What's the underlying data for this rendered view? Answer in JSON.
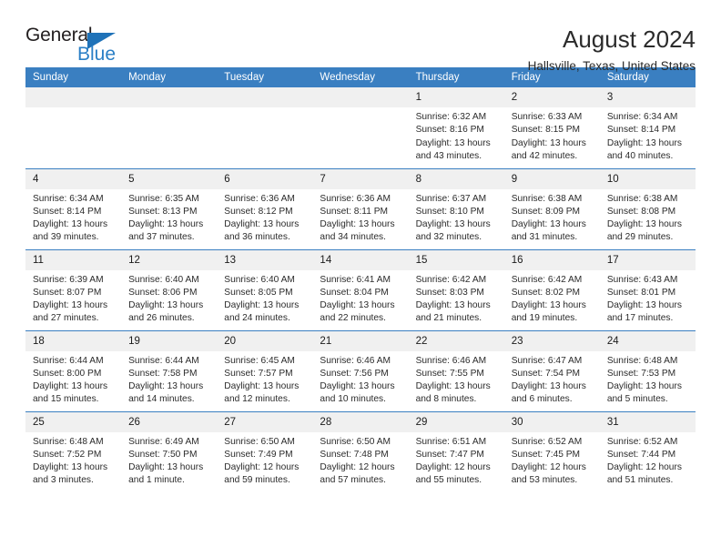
{
  "brand": {
    "name_part1": "General",
    "name_part2": "Blue",
    "triangle_color": "#1f72b8",
    "blue_color": "#2a7fc6"
  },
  "header": {
    "title": "August 2024",
    "subtitle": "Hallsville, Texas, United States"
  },
  "theme": {
    "header_blue": "#3a7fc1",
    "daynum_band": "#f0f0f0",
    "text": "#2b2b2b"
  },
  "weekday_headers": [
    "Sunday",
    "Monday",
    "Tuesday",
    "Wednesday",
    "Thursday",
    "Friday",
    "Saturday"
  ],
  "weeks": [
    [
      {
        "day": "",
        "sunrise": "",
        "sunset": "",
        "daylight_line1": "",
        "daylight_line2": "",
        "empty": true
      },
      {
        "day": "",
        "sunrise": "",
        "sunset": "",
        "daylight_line1": "",
        "daylight_line2": "",
        "empty": true
      },
      {
        "day": "",
        "sunrise": "",
        "sunset": "",
        "daylight_line1": "",
        "daylight_line2": "",
        "empty": true
      },
      {
        "day": "",
        "sunrise": "",
        "sunset": "",
        "daylight_line1": "",
        "daylight_line2": "",
        "empty": true
      },
      {
        "day": "1",
        "sunrise": "Sunrise: 6:32 AM",
        "sunset": "Sunset: 8:16 PM",
        "daylight_line1": "Daylight: 13 hours",
        "daylight_line2": "and 43 minutes."
      },
      {
        "day": "2",
        "sunrise": "Sunrise: 6:33 AM",
        "sunset": "Sunset: 8:15 PM",
        "daylight_line1": "Daylight: 13 hours",
        "daylight_line2": "and 42 minutes."
      },
      {
        "day": "3",
        "sunrise": "Sunrise: 6:34 AM",
        "sunset": "Sunset: 8:14 PM",
        "daylight_line1": "Daylight: 13 hours",
        "daylight_line2": "and 40 minutes."
      }
    ],
    [
      {
        "day": "4",
        "sunrise": "Sunrise: 6:34 AM",
        "sunset": "Sunset: 8:14 PM",
        "daylight_line1": "Daylight: 13 hours",
        "daylight_line2": "and 39 minutes."
      },
      {
        "day": "5",
        "sunrise": "Sunrise: 6:35 AM",
        "sunset": "Sunset: 8:13 PM",
        "daylight_line1": "Daylight: 13 hours",
        "daylight_line2": "and 37 minutes."
      },
      {
        "day": "6",
        "sunrise": "Sunrise: 6:36 AM",
        "sunset": "Sunset: 8:12 PM",
        "daylight_line1": "Daylight: 13 hours",
        "daylight_line2": "and 36 minutes."
      },
      {
        "day": "7",
        "sunrise": "Sunrise: 6:36 AM",
        "sunset": "Sunset: 8:11 PM",
        "daylight_line1": "Daylight: 13 hours",
        "daylight_line2": "and 34 minutes."
      },
      {
        "day": "8",
        "sunrise": "Sunrise: 6:37 AM",
        "sunset": "Sunset: 8:10 PM",
        "daylight_line1": "Daylight: 13 hours",
        "daylight_line2": "and 32 minutes."
      },
      {
        "day": "9",
        "sunrise": "Sunrise: 6:38 AM",
        "sunset": "Sunset: 8:09 PM",
        "daylight_line1": "Daylight: 13 hours",
        "daylight_line2": "and 31 minutes."
      },
      {
        "day": "10",
        "sunrise": "Sunrise: 6:38 AM",
        "sunset": "Sunset: 8:08 PM",
        "daylight_line1": "Daylight: 13 hours",
        "daylight_line2": "and 29 minutes."
      }
    ],
    [
      {
        "day": "11",
        "sunrise": "Sunrise: 6:39 AM",
        "sunset": "Sunset: 8:07 PM",
        "daylight_line1": "Daylight: 13 hours",
        "daylight_line2": "and 27 minutes."
      },
      {
        "day": "12",
        "sunrise": "Sunrise: 6:40 AM",
        "sunset": "Sunset: 8:06 PM",
        "daylight_line1": "Daylight: 13 hours",
        "daylight_line2": "and 26 minutes."
      },
      {
        "day": "13",
        "sunrise": "Sunrise: 6:40 AM",
        "sunset": "Sunset: 8:05 PM",
        "daylight_line1": "Daylight: 13 hours",
        "daylight_line2": "and 24 minutes."
      },
      {
        "day": "14",
        "sunrise": "Sunrise: 6:41 AM",
        "sunset": "Sunset: 8:04 PM",
        "daylight_line1": "Daylight: 13 hours",
        "daylight_line2": "and 22 minutes."
      },
      {
        "day": "15",
        "sunrise": "Sunrise: 6:42 AM",
        "sunset": "Sunset: 8:03 PM",
        "daylight_line1": "Daylight: 13 hours",
        "daylight_line2": "and 21 minutes."
      },
      {
        "day": "16",
        "sunrise": "Sunrise: 6:42 AM",
        "sunset": "Sunset: 8:02 PM",
        "daylight_line1": "Daylight: 13 hours",
        "daylight_line2": "and 19 minutes."
      },
      {
        "day": "17",
        "sunrise": "Sunrise: 6:43 AM",
        "sunset": "Sunset: 8:01 PM",
        "daylight_line1": "Daylight: 13 hours",
        "daylight_line2": "and 17 minutes."
      }
    ],
    [
      {
        "day": "18",
        "sunrise": "Sunrise: 6:44 AM",
        "sunset": "Sunset: 8:00 PM",
        "daylight_line1": "Daylight: 13 hours",
        "daylight_line2": "and 15 minutes."
      },
      {
        "day": "19",
        "sunrise": "Sunrise: 6:44 AM",
        "sunset": "Sunset: 7:58 PM",
        "daylight_line1": "Daylight: 13 hours",
        "daylight_line2": "and 14 minutes."
      },
      {
        "day": "20",
        "sunrise": "Sunrise: 6:45 AM",
        "sunset": "Sunset: 7:57 PM",
        "daylight_line1": "Daylight: 13 hours",
        "daylight_line2": "and 12 minutes."
      },
      {
        "day": "21",
        "sunrise": "Sunrise: 6:46 AM",
        "sunset": "Sunset: 7:56 PM",
        "daylight_line1": "Daylight: 13 hours",
        "daylight_line2": "and 10 minutes."
      },
      {
        "day": "22",
        "sunrise": "Sunrise: 6:46 AM",
        "sunset": "Sunset: 7:55 PM",
        "daylight_line1": "Daylight: 13 hours",
        "daylight_line2": "and 8 minutes."
      },
      {
        "day": "23",
        "sunrise": "Sunrise: 6:47 AM",
        "sunset": "Sunset: 7:54 PM",
        "daylight_line1": "Daylight: 13 hours",
        "daylight_line2": "and 6 minutes."
      },
      {
        "day": "24",
        "sunrise": "Sunrise: 6:48 AM",
        "sunset": "Sunset: 7:53 PM",
        "daylight_line1": "Daylight: 13 hours",
        "daylight_line2": "and 5 minutes."
      }
    ],
    [
      {
        "day": "25",
        "sunrise": "Sunrise: 6:48 AM",
        "sunset": "Sunset: 7:52 PM",
        "daylight_line1": "Daylight: 13 hours",
        "daylight_line2": "and 3 minutes."
      },
      {
        "day": "26",
        "sunrise": "Sunrise: 6:49 AM",
        "sunset": "Sunset: 7:50 PM",
        "daylight_line1": "Daylight: 13 hours",
        "daylight_line2": "and 1 minute."
      },
      {
        "day": "27",
        "sunrise": "Sunrise: 6:50 AM",
        "sunset": "Sunset: 7:49 PM",
        "daylight_line1": "Daylight: 12 hours",
        "daylight_line2": "and 59 minutes."
      },
      {
        "day": "28",
        "sunrise": "Sunrise: 6:50 AM",
        "sunset": "Sunset: 7:48 PM",
        "daylight_line1": "Daylight: 12 hours",
        "daylight_line2": "and 57 minutes."
      },
      {
        "day": "29",
        "sunrise": "Sunrise: 6:51 AM",
        "sunset": "Sunset: 7:47 PM",
        "daylight_line1": "Daylight: 12 hours",
        "daylight_line2": "and 55 minutes."
      },
      {
        "day": "30",
        "sunrise": "Sunrise: 6:52 AM",
        "sunset": "Sunset: 7:45 PM",
        "daylight_line1": "Daylight: 12 hours",
        "daylight_line2": "and 53 minutes."
      },
      {
        "day": "31",
        "sunrise": "Sunrise: 6:52 AM",
        "sunset": "Sunset: 7:44 PM",
        "daylight_line1": "Daylight: 12 hours",
        "daylight_line2": "and 51 minutes."
      }
    ]
  ]
}
